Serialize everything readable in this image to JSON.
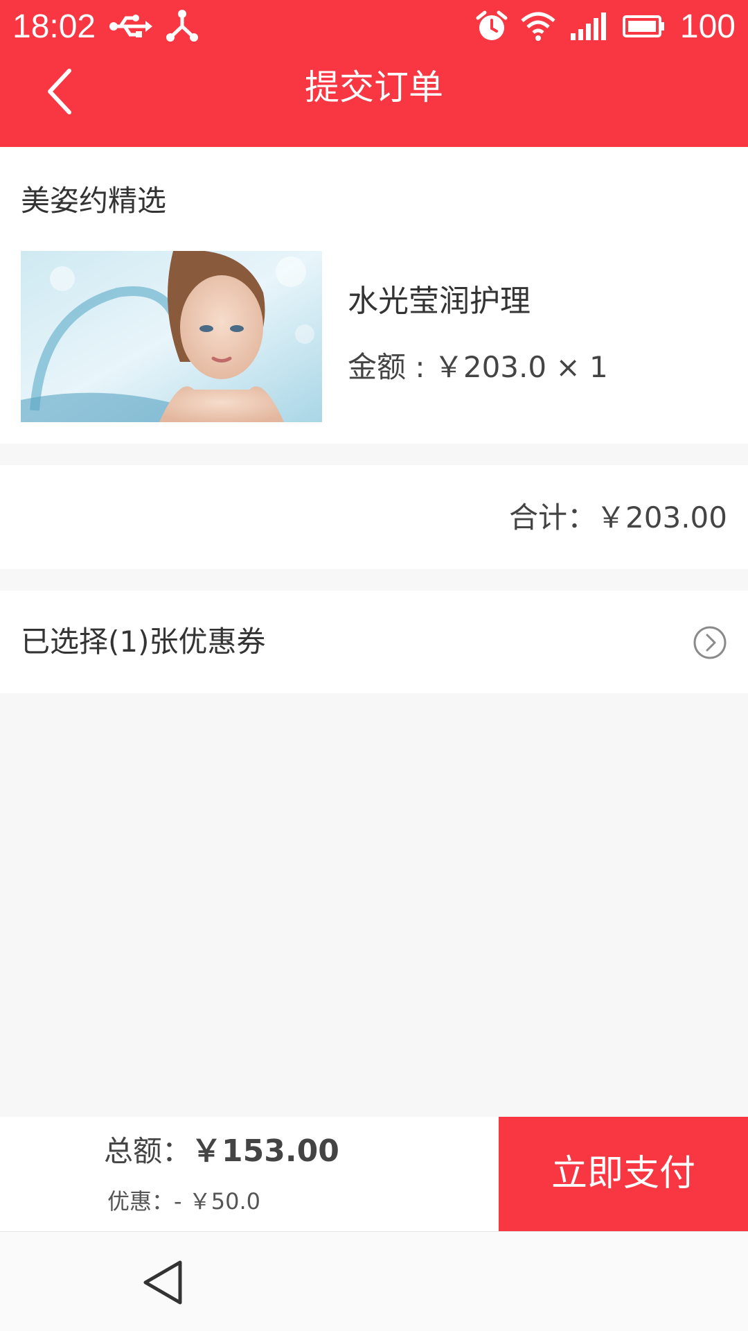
{
  "status_bar": {
    "time": "18:02",
    "battery": "100",
    "icons": [
      "usb-icon",
      "share-icon",
      "alarm-icon",
      "wifi-icon",
      "signal-icon",
      "battery-icon"
    ]
  },
  "header": {
    "title": "提交订单",
    "back_icon": "chevron-left-icon",
    "background_color": "#f93743"
  },
  "order": {
    "store_name": "美姿约精选",
    "product": {
      "name": "水光莹润护理",
      "price_text": "金额 : ￥203.0 × 1"
    }
  },
  "subtotal": {
    "text": "合计：￥203.00"
  },
  "coupon": {
    "text": "已选择(1)张优惠券",
    "arrow_icon": "chevron-right-circle-icon"
  },
  "footer": {
    "total_label": "总额：",
    "total_value": "￥153.00",
    "discount_label": "优惠：",
    "discount_value": "- ￥50.0",
    "pay_button": "立即支付"
  },
  "nav": {
    "back_icon": "triangle-back-icon"
  }
}
